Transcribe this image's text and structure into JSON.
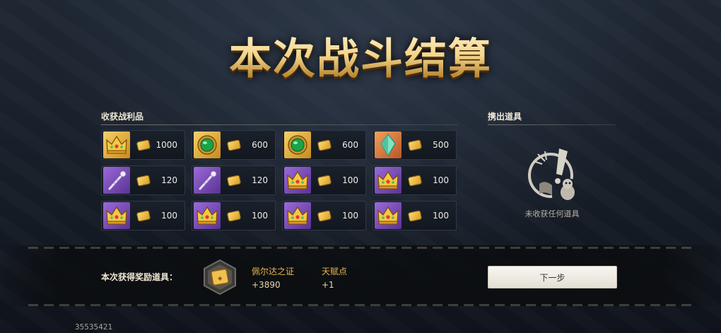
{
  "title": "本次战斗结算",
  "loot": {
    "label": "收获战利品",
    "items": [
      {
        "icon": "golden-crown-icon",
        "frame": "gold",
        "amount": "1000"
      },
      {
        "icon": "emerald-medallion-icon",
        "frame": "gold",
        "amount": "600"
      },
      {
        "icon": "emerald-medallion-icon",
        "frame": "gold",
        "amount": "600"
      },
      {
        "icon": "green-crystal-icon",
        "frame": "orange",
        "amount": "500"
      },
      {
        "icon": "silver-scepter-icon",
        "frame": "purple",
        "amount": "120"
      },
      {
        "icon": "silver-scepter-icon",
        "frame": "purple",
        "amount": "120"
      },
      {
        "icon": "golden-crown-icon",
        "frame": "purple",
        "amount": "100"
      },
      {
        "icon": "golden-crown-icon",
        "frame": "purple",
        "amount": "100"
      },
      {
        "icon": "golden-crown-icon",
        "frame": "purple",
        "amount": "100"
      },
      {
        "icon": "golden-crown-icon",
        "frame": "purple",
        "amount": "100"
      },
      {
        "icon": "golden-crown-icon",
        "frame": "purple",
        "amount": "100"
      },
      {
        "icon": "golden-crown-icon",
        "frame": "purple",
        "amount": "100"
      }
    ]
  },
  "dropped": {
    "label": "携出道具",
    "empty_text": "未收获任何道具",
    "empty_icon": "empty-bag-bird-icon"
  },
  "rewards": {
    "label": "本次获得奖励道具：",
    "icon": "pelda-certificate-icon",
    "items": [
      {
        "name": "佩尔达之证",
        "value": "+3890"
      },
      {
        "name": "天赋点",
        "value": "+1"
      }
    ]
  },
  "next_button": "下一步",
  "player_id": "35535421",
  "colors": {
    "accent_gold": "#e9b64c",
    "frame_gold": "#f6d26a",
    "frame_purple": "#9a6ad8",
    "frame_orange": "#f2a05c"
  }
}
